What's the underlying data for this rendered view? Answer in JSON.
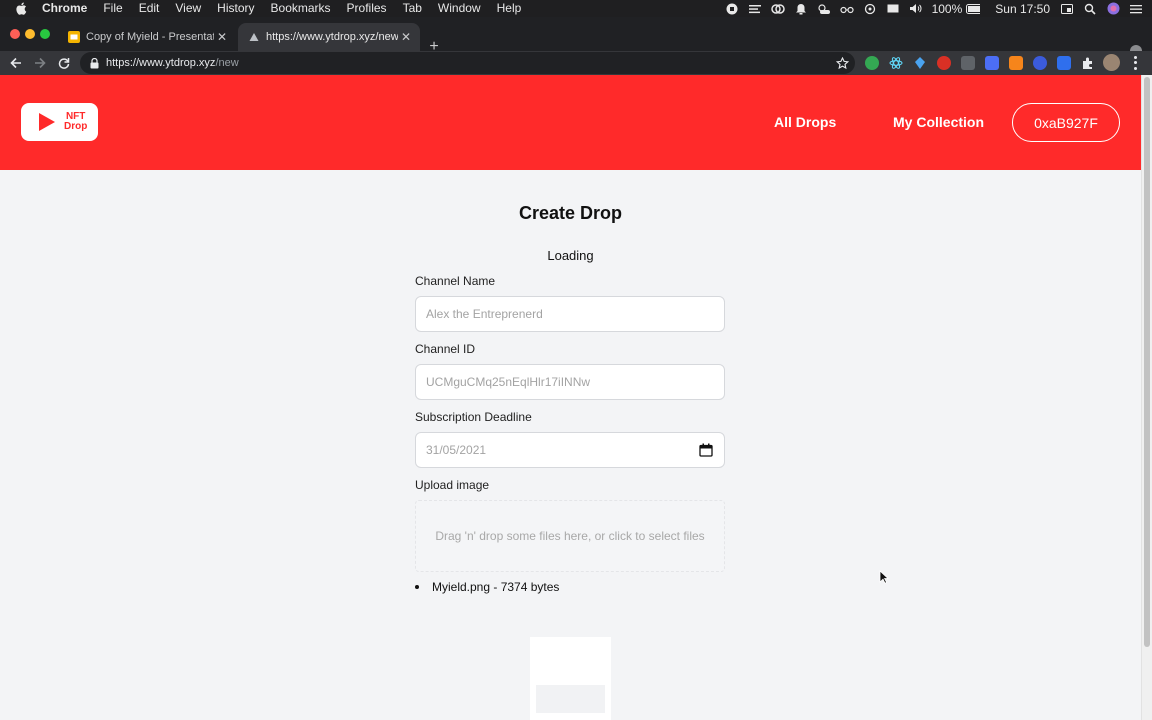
{
  "menubar": {
    "app": "Chrome",
    "items": [
      "File",
      "Edit",
      "View",
      "History",
      "Bookmarks",
      "Profiles",
      "Tab",
      "Window",
      "Help"
    ],
    "battery": "100%",
    "clock": "Sun 17:50"
  },
  "tabs": [
    {
      "title": "Copy of Myield - Presentation",
      "icon": "slides-icon"
    },
    {
      "title": "https://www.ytdrop.xyz/new",
      "icon": "site-icon"
    }
  ],
  "omnibox": {
    "host": "https://www.ytdrop.xyz",
    "path": "/new"
  },
  "header": {
    "logo_text_line1": "NFT",
    "logo_text_line2": "Drop",
    "nav": [
      {
        "label": "All Drops"
      },
      {
        "label": "My Collection"
      }
    ],
    "wallet": "0xaB927F",
    "color": "#ff2a2a"
  },
  "main": {
    "title": "Create Drop",
    "status": "Loading",
    "fields": [
      {
        "label": "Channel Name",
        "placeholder": "Alex the Entreprenerd"
      },
      {
        "label": "Channel ID",
        "placeholder": "UCMguCMq25nEqlHlr17iINNw"
      },
      {
        "label": "Subscription Deadline",
        "value": "31/05/2021"
      }
    ],
    "upload": {
      "label": "Upload image",
      "hint": "Drag 'n' drop some files here, or click to select files",
      "files": [
        {
          "entry": "Myield.png - 7374 bytes"
        }
      ]
    }
  }
}
